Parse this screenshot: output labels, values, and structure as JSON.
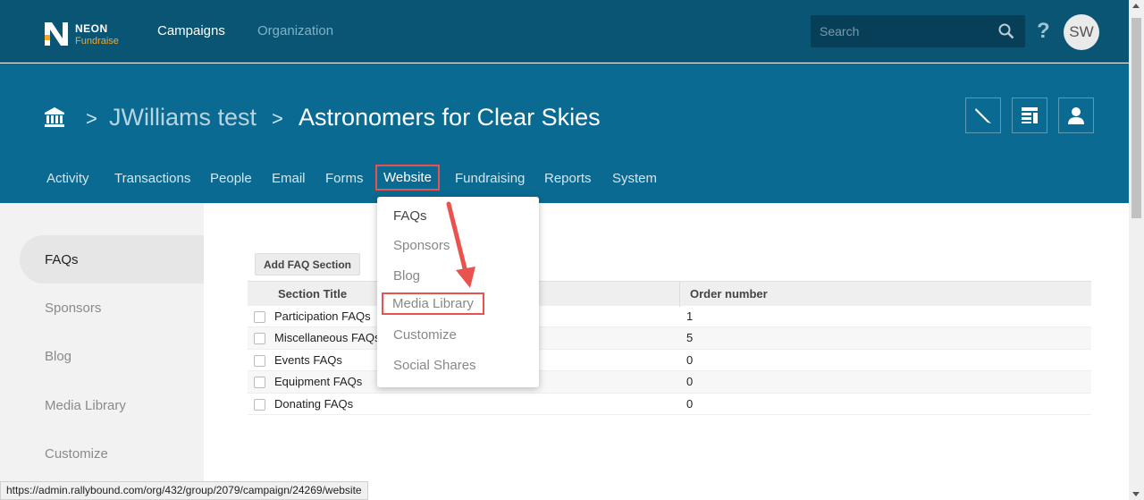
{
  "topbar": {
    "logo_neon": "NEON",
    "logo_fundraise": "Fundraise",
    "nav": [
      "Campaigns",
      "Organization"
    ],
    "search_placeholder": "Search",
    "help": "?",
    "avatar": "SW"
  },
  "header": {
    "breadcrumb": [
      "JWilliams test",
      "Astronomers for Clear Skies"
    ],
    "separator": ">",
    "subnav": [
      "Activity",
      "Transactions",
      "People",
      "Email",
      "Forms",
      "Website",
      "Fundraising",
      "Reports",
      "System"
    ],
    "active_tab": "Website",
    "icons": [
      "edit-icon",
      "layout-icon",
      "user-icon"
    ]
  },
  "dropdown": {
    "items": [
      "FAQs",
      "Sponsors",
      "Blog",
      "Media Library",
      "Customize",
      "Social Shares"
    ],
    "highlighted": "Media Library"
  },
  "sidebar": {
    "items": [
      "FAQs",
      "Sponsors",
      "Blog",
      "Media Library",
      "Customize"
    ],
    "active": "FAQs"
  },
  "main": {
    "add_button": "Add FAQ Section",
    "columns": [
      "Section Title",
      "Order number"
    ],
    "rows": [
      {
        "title": "Participation FAQs",
        "order": "1"
      },
      {
        "title": "Miscellaneous FAQs",
        "order": "5"
      },
      {
        "title": "Events FAQs",
        "order": "0"
      },
      {
        "title": "Equipment FAQs",
        "order": "0"
      },
      {
        "title": "Donating FAQs",
        "order": "0"
      }
    ]
  },
  "status_url": "https://admin.rallybound.com/org/432/group/2079/campaign/24269/website",
  "colors": {
    "topbar": "#0a5474",
    "header": "#0a6a92",
    "highlight": "#e9534f",
    "logo_accent": "#f7a823"
  }
}
